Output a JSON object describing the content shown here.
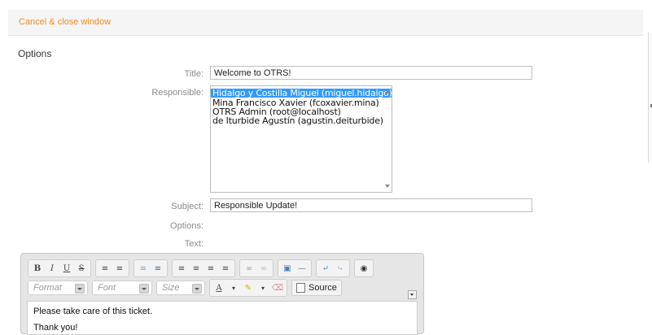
{
  "topbar": {
    "cancel_label": "Cancel & close window"
  },
  "section": {
    "title": "Options"
  },
  "form": {
    "title_label": "Title:",
    "title_value": "Welcome to OTRS!",
    "responsible_label": "Responsible:",
    "responsible_options": [
      "Hidalgo y Costilla Miguel (miguel.hidalgo)",
      "Mina Francisco Xavier (fcoxavier.mina)",
      "OTRS Admin (root@localhost)",
      "de Iturbide Agustín (agustin.deiturbide)"
    ],
    "responsible_selected_index": 0,
    "subject_label": "Subject:",
    "subject_value": "Responsible Update!",
    "options_label": "Options:",
    "text_label": "Text:"
  },
  "editor": {
    "row1_buttons": [
      "B",
      "I",
      "U",
      "S",
      "ordered-list-icon",
      "bullet-list-icon",
      "outdent-icon",
      "indent-icon",
      "align-left-icon",
      "align-center-icon",
      "align-right-icon",
      "justify-icon",
      "link-icon",
      "unlink-icon",
      "image-icon",
      "horizontal-rule-icon",
      "undo-icon",
      "redo-icon",
      "find-icon"
    ],
    "format_placeholder": "Format",
    "font_placeholder": "Font",
    "size_placeholder": "Size",
    "source_label": "Source",
    "body_lines": [
      "Please take care of this ticket.",
      "Thank you!"
    ]
  },
  "colors": {
    "link": "#f58a1f",
    "selection": "#3399ff"
  }
}
